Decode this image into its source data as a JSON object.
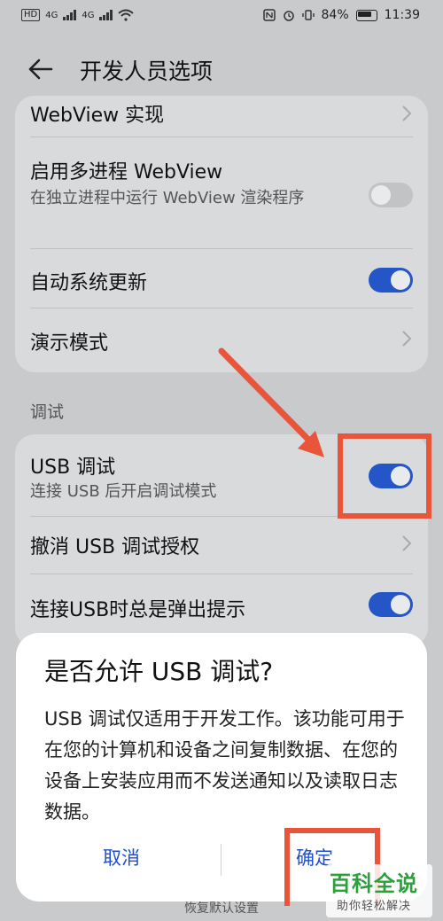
{
  "status_bar": {
    "left_tag": "HD",
    "net1": "4G",
    "net2": "4G",
    "battery_percent": "84%",
    "time": "11:39",
    "icons": [
      "nfc-icon",
      "alarm-icon",
      "vibrate-icon",
      "battery-icon",
      "wifi-icon"
    ]
  },
  "header": {
    "title": "开发人员选项",
    "back_icon": "arrow-left-icon"
  },
  "card1": {
    "items": [
      {
        "label": "WebView 实现",
        "control": "chevron"
      },
      {
        "label": "启用多进程 WebView",
        "sub": "在独立进程中运行 WebView 渲染程序",
        "control": "toggle",
        "on": false
      },
      {
        "label": "自动系统更新",
        "control": "toggle",
        "on": true
      },
      {
        "label": "演示模式",
        "control": "chevron"
      }
    ]
  },
  "section_debug": "调试",
  "card2": {
    "items": [
      {
        "label": "USB 调试",
        "sub": "连接 USB 后开启调试模式",
        "control": "toggle",
        "on": true
      },
      {
        "label": "撤消 USB 调试授权",
        "control": "chevron"
      },
      {
        "label": "连接USB时总是弹出提示",
        "control": "toggle",
        "on": true
      }
    ]
  },
  "dialog": {
    "title": "是否允许 USB 调试?",
    "body": "USB 调试仅适用于开发工作。该功能可用于在您的计算机和设备之间复制数据、在您的设备上安装应用而不发送通知以及读取日志数据。",
    "cancel_label": "取消",
    "confirm_label": "确定"
  },
  "bottom_hidden": "恢复默认设置",
  "watermark": {
    "logo": "百科全说",
    "sub": "助你轻松解决"
  },
  "colors": {
    "accent": "#2456c8",
    "annotation": "#e8553a",
    "background": "#c9cacc",
    "card": "#d9dadc"
  }
}
